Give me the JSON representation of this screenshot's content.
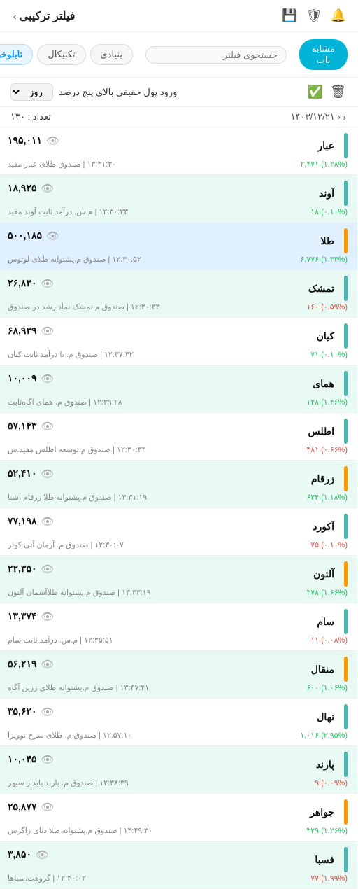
{
  "header": {
    "title": "فیلتر ترکیبی",
    "chevron": "›",
    "icons": [
      "🔔",
      "🛡",
      "💾"
    ]
  },
  "tabs": {
    "items": [
      {
        "label": "تابلوخوانی",
        "active": true
      },
      {
        "label": "تکنیکال",
        "active": false
      },
      {
        "label": "بنیادی",
        "active": false
      }
    ],
    "search_placeholder": "جستجوی فیلتر",
    "search_btn": "مشابه یاب"
  },
  "filter": {
    "desc": "ورود پول حقیقی بالای پنج درصد",
    "day_option": "روز"
  },
  "stats": {
    "count_label": "تعداد : ۱۳۰",
    "date": "‹  ۱۴۰۳/۱۲/۲۱"
  },
  "funds": [
    {
      "name": "عبار",
      "color": "#4db6ac",
      "desc": "۱۳:۳۱:۳۰  |  صندوق طلای عبار مفید",
      "value": "۱۹۵,۰۱۱",
      "change": "۲,۴۷۱ (۱.۲۸%)",
      "positive": true,
      "highlight": ""
    },
    {
      "name": "آوند",
      "color": "#4db6ac",
      "desc": "۱۲:۳۰:۳۳  |  م.س. درآمد ثابت آوند مفید",
      "value": "۱۸,۹۲۵",
      "change": "۱۸ (۰.۱۰%)",
      "positive": true,
      "highlight": "highlighted"
    },
    {
      "name": "طلا",
      "color": "#ff9800",
      "desc": "۱۲:۳۰:۵۲  |  صندوق م.پشتوانه طلای لوتوس",
      "value": "۵۰۰,۱۸۵",
      "change": "۶,۷۷۶ (۱.۳۴%)",
      "positive": true,
      "highlight": "highlighted2"
    },
    {
      "name": "تمشک",
      "color": "#4db6ac",
      "desc": "۱۲:۳۰:۳۳  |  صندوق م.تمشک نماد رشد در صندوق",
      "value": "۲۶,۸۳۰",
      "change": "۱۶۰ (۰.۵۹%)",
      "positive": false,
      "highlight": "highlighted"
    },
    {
      "name": "کیان",
      "color": "#4db6ac",
      "desc": "۱۲:۳۷:۴۲  |  صندوق م. با درآمد ثابت کیان",
      "value": "۶۸,۹۳۹",
      "change": "۷۱ (۰.۱۰%)",
      "positive": true,
      "highlight": ""
    },
    {
      "name": "همای",
      "color": "#4db6ac",
      "desc": "۱۲:۳۹:۲۸  |  صندوق م. همای آگاه‌ثابت",
      "value": "۱۰,۰۰۹",
      "change": "۱۴۸ (۱.۴۶%)",
      "positive": true,
      "highlight": "highlighted"
    },
    {
      "name": "اطلس",
      "color": "#4db6ac",
      "desc": "۱۲:۳۰:۳۳  |  صندوق م.توسعه اطلس مفید.س",
      "value": "۵۷,۱۴۳",
      "change": "۳۸۱ (۰.۶۶%)",
      "positive": false,
      "highlight": ""
    },
    {
      "name": "زرقام",
      "color": "#ff9800",
      "desc": "۱۳:۳۱:۱۹  |  صندوق م.پشتوانه طلا زرقام آشنا",
      "value": "۵۲,۴۱۰",
      "change": "۶۲۴ (۱.۱۸%)",
      "positive": true,
      "highlight": "highlighted"
    },
    {
      "name": "آکورد",
      "color": "#4db6ac",
      "desc": "۱۲:۳۰:۰۷  |  صندوق م. آرمان آتی کوثر",
      "value": "۷۷,۱۹۸",
      "change": "۷۵ (۰.۱۰%)",
      "positive": false,
      "highlight": ""
    },
    {
      "name": "آلتون",
      "color": "#ff9800",
      "desc": "۱۳:۳۳:۱۹  |  صندوق م.پشتوانه طلاآسمان آلتون",
      "value": "۲۲,۳۵۰",
      "change": "۳۷۸ (۱.۶۶%)",
      "positive": true,
      "highlight": "highlighted"
    },
    {
      "name": "سام",
      "color": "#4db6ac",
      "desc": "۱۲:۳۵:۵۱  |  م.س. درآمد ثابت سام",
      "value": "۱۳,۳۷۴",
      "change": "۱۱ (۰.۰۸%)",
      "positive": false,
      "highlight": ""
    },
    {
      "name": "منقال",
      "color": "#ff9800",
      "desc": "۱۳:۴۷:۴۱  |  صندوق م.پشتوانه طلای زرین آگاه",
      "value": "۵۶,۲۱۹",
      "change": "۶۰۰ (۱.۰۶%)",
      "positive": true,
      "highlight": "highlighted"
    },
    {
      "name": "نهال",
      "color": "#4db6ac",
      "desc": "۱۲:۵۷:۱۰  |  صندوق م. طلای سرخ نوویرا",
      "value": "۳۵,۶۲۰",
      "change": "۱,۰۱۶ (۲.۹۵%)",
      "positive": true,
      "highlight": ""
    },
    {
      "name": "پارند",
      "color": "#4db6ac",
      "desc": "۱۲:۳۸:۳۹  |  صندوق م. پارند پایدار سپهر",
      "value": "۱۰,۰۴۵",
      "change": "۹ (۰.۰۹%)",
      "positive": false,
      "highlight": "highlighted"
    },
    {
      "name": "جواهر",
      "color": "#ff9800",
      "desc": "۱۳:۴۹:۳۰  |  صندوق م.پشتوانه طلا دنای زاگرس",
      "value": "۲۵,۸۷۷",
      "change": "۳۲۹ (۱.۲۶%)",
      "positive": true,
      "highlight": ""
    },
    {
      "name": "فسبا",
      "color": "#4db6ac",
      "desc": "۱۲:۳۰:۰۲  |  گروهت.سیاها",
      "value": "۳,۸۵۰",
      "change": "۷۷ (۱.۹۹%)",
      "positive": false,
      "highlight": "highlighted"
    }
  ]
}
